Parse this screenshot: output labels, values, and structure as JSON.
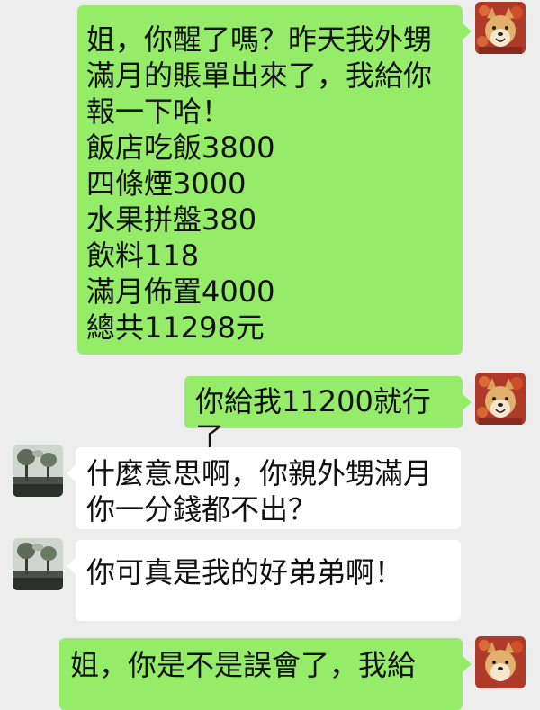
{
  "messages": [
    {
      "side": "sent",
      "text": "姐，你醒了嗎？昨天我外甥\n滿月的賬單出來了，我給你\n報一下哈！\n飯店吃飯3800\n四條煙3000\n水果拼盤380\n飲料118\n滿月佈置4000\n總共11298元"
    },
    {
      "side": "sent",
      "text": "你給我11200就行了"
    },
    {
      "side": "received",
      "text": "什麼意思啊，你親外甥滿月\n你一分錢都不出？"
    },
    {
      "side": "received",
      "text": "你可真是我的好弟弟啊！"
    },
    {
      "side": "sent",
      "text": "姐，你是不是誤會了，我給"
    }
  ],
  "avatars": {
    "self": "shiba-dog-avatar",
    "sister": "tree-landscape-avatar"
  },
  "colors": {
    "background": "#ededed",
    "sent_bubble": "#95ec69",
    "received_bubble": "#ffffff"
  }
}
